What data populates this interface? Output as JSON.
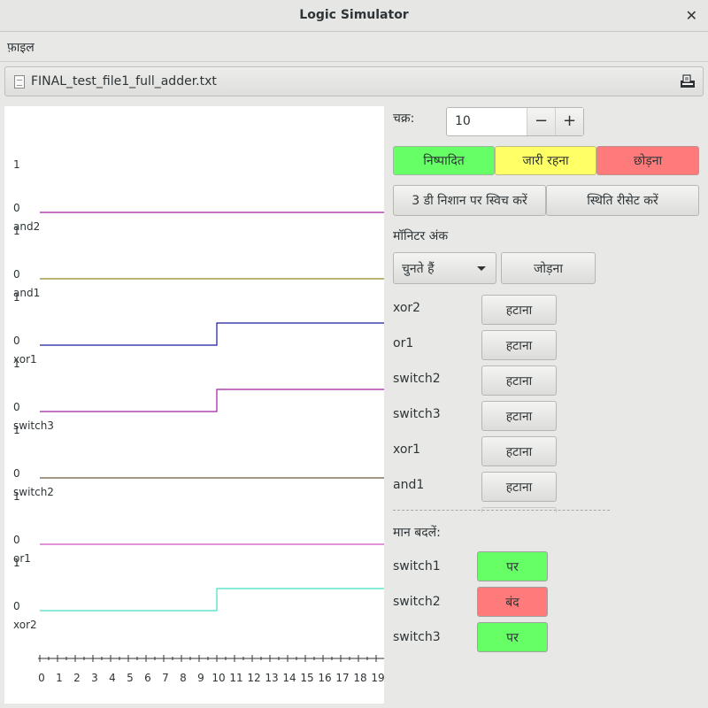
{
  "window": {
    "title": "Logic Simulator",
    "close_glyph": "✕"
  },
  "menubar": {
    "file": "फ़ाइल"
  },
  "filebar": {
    "filename": "FINAL_test_file1_full_adder.txt",
    "doc_icon": "document-icon",
    "open_icon": "open-file-icon"
  },
  "canvas": {
    "hi_label": "1",
    "lo_label": "0",
    "axis_ticks": [
      "0",
      "1",
      "2",
      "3",
      "4",
      "5",
      "6",
      "7",
      "8",
      "9",
      "10",
      "11",
      "12",
      "13",
      "14",
      "15",
      "16",
      "17",
      "18",
      "19"
    ],
    "signals": [
      {
        "name": "and2",
        "color": "#a020a0",
        "switch_at": null
      },
      {
        "name": "and1",
        "color": "#8b8b1f",
        "switch_at": null
      },
      {
        "name": "xor1",
        "color": "#1a1a9a",
        "switch_at": 10
      },
      {
        "name": "switch3",
        "color": "#a020a0",
        "switch_at": 10
      },
      {
        "name": "switch2",
        "color": "#6a5a3a",
        "switch_at": null
      },
      {
        "name": "or1",
        "color": "#d050c0",
        "switch_at": null
      },
      {
        "name": "xor2",
        "color": "#40e0c0",
        "switch_at": 10
      }
    ]
  },
  "controls": {
    "cycles_label": "चक्र:",
    "cycles_value": "10",
    "minus": "−",
    "plus": "+",
    "run": "निष्पादित",
    "continue": "जारी रहना",
    "quit": "छोड़ना",
    "switch_3d": "3 डी निशान पर स्विच करें",
    "reset_state": "स्थिति रीसेट करें",
    "monitor_heading": "मॉनिटर अंक",
    "select_placeholder": "चुनते हैं",
    "add": "जोड़ना",
    "remove_label": "हटाना",
    "monitors": [
      "xor2",
      "or1",
      "switch2",
      "switch3",
      "xor1",
      "and1"
    ],
    "change_values_heading": "मान बदलें:",
    "switches": [
      {
        "name": "switch1",
        "state": "पर",
        "color": "#66ff66"
      },
      {
        "name": "switch2",
        "state": "बंद",
        "color": "#ff7b7b"
      },
      {
        "name": "switch3",
        "state": "पर",
        "color": "#66ff66"
      }
    ]
  }
}
